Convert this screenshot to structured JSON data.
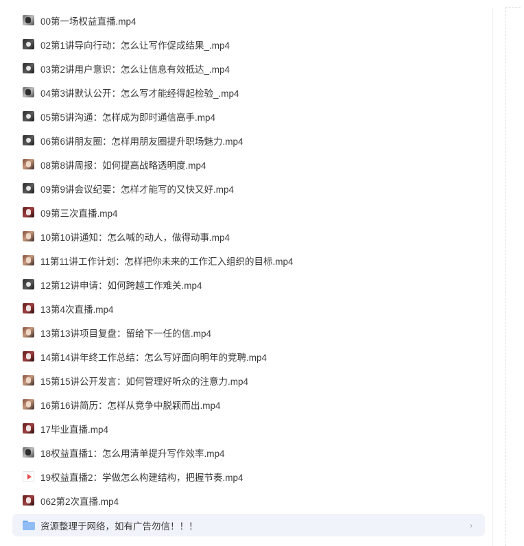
{
  "files": [
    {
      "name": "00第一场权益直播.mp4",
      "icon": "video-thumbnail-icon",
      "style": "t-gray"
    },
    {
      "name": "02第1讲导向行动：怎么让写作促成结果_.mp4",
      "icon": "video-thumbnail-icon",
      "style": "t-dark"
    },
    {
      "name": "03第2讲用户意识：怎么让信息有效抵达_.mp4",
      "icon": "video-thumbnail-icon",
      "style": "t-dark"
    },
    {
      "name": "04第3讲默认公开：怎么写才能经得起检验_.mp4",
      "icon": "video-thumbnail-icon",
      "style": "t-gray"
    },
    {
      "name": "05第5讲沟通：怎样成为即时通信高手.mp4",
      "icon": "video-thumbnail-icon",
      "style": "t-dark"
    },
    {
      "name": "06第6讲朋友圈：怎样用朋友圈提升职场魅力.mp4",
      "icon": "video-thumbnail-icon",
      "style": "t-dark"
    },
    {
      "name": "08第8讲周报：如何提高战略透明度.mp4",
      "icon": "video-thumbnail-icon",
      "style": "t-warm"
    },
    {
      "name": "09第9讲会议纪要：怎样才能写的又快又好.mp4",
      "icon": "video-thumbnail-icon",
      "style": "t-dark"
    },
    {
      "name": "09第三次直播.mp4",
      "icon": "video-thumbnail-icon",
      "style": "t-red"
    },
    {
      "name": "10第10讲通知：怎么喊的动人，做得动事.mp4",
      "icon": "video-thumbnail-icon",
      "style": "t-warm"
    },
    {
      "name": "11第11讲工作计划：怎样把你未来的工作汇入组织的目标.mp4",
      "icon": "video-thumbnail-icon",
      "style": "t-warm"
    },
    {
      "name": "12第12讲申请：如何跨越工作难关.mp4",
      "icon": "video-thumbnail-icon",
      "style": "t-dark"
    },
    {
      "name": "13第4次直播.mp4",
      "icon": "video-thumbnail-icon",
      "style": "t-red"
    },
    {
      "name": "13第13讲项目复盘：留给下一任的信.mp4",
      "icon": "video-thumbnail-icon",
      "style": "t-warm"
    },
    {
      "name": "14第14讲年终工作总结：怎么写好面向明年的竞聘.mp4",
      "icon": "video-thumbnail-icon",
      "style": "t-red"
    },
    {
      "name": "15第15讲公开发言：如何管理好听众的注意力.mp4",
      "icon": "video-thumbnail-icon",
      "style": "t-warm"
    },
    {
      "name": "16第16讲简历：怎样从竞争中脱颖而出.mp4",
      "icon": "video-thumbnail-icon",
      "style": "t-warm"
    },
    {
      "name": "17毕业直播.mp4",
      "icon": "video-thumbnail-icon",
      "style": "t-red"
    },
    {
      "name": "18权益直播1：怎么用清单提升写作效率.mp4",
      "icon": "video-thumbnail-icon",
      "style": "t-gray"
    },
    {
      "name": "19权益直播2：学做怎么构建结构，把握节奏.mp4",
      "icon": "video-file-icon",
      "style": "t-play"
    },
    {
      "name": "062第2次直播.mp4",
      "icon": "video-thumbnail-icon",
      "style": "t-red"
    }
  ],
  "folder": {
    "name": "资源整理于网络，如有广告勿信！！！",
    "icon": "folder-icon",
    "chevron": "›"
  },
  "colors": {
    "folder_row_bg": "#f1f3fb",
    "folder_icon": "#8fbdf4",
    "play_icon": "#e84a4a"
  }
}
